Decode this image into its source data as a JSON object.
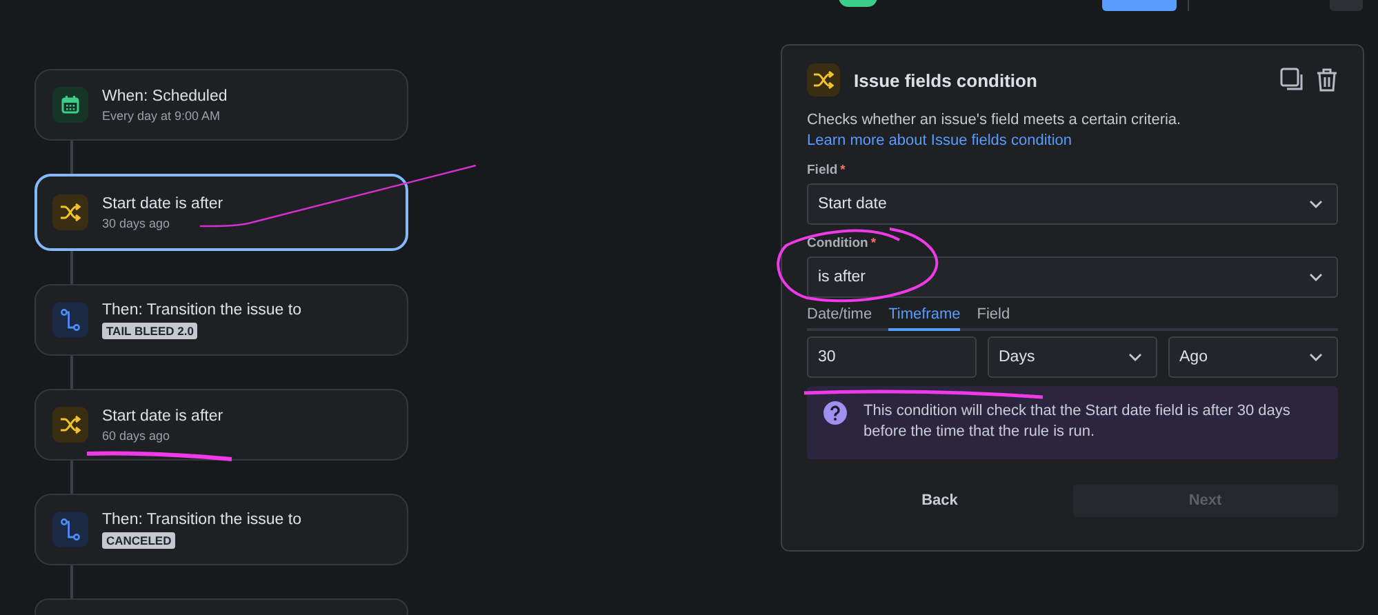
{
  "top_bar": {
    "toggle": {
      "on": true
    }
  },
  "flow": [
    {
      "kind": "trigger",
      "title": "When: Scheduled",
      "subtitle": "Every day at 9:00 AM",
      "selected": false
    },
    {
      "kind": "condition",
      "title": "Start date is after",
      "subtitle": "30 days ago",
      "selected": true
    },
    {
      "kind": "action",
      "title": "Then: Transition the issue to",
      "badge": "TAIL BLEED 2.0",
      "selected": false
    },
    {
      "kind": "condition",
      "title": "Start date is after",
      "subtitle": "60 days ago",
      "selected": false
    },
    {
      "kind": "action",
      "title": "Then: Transition the issue to",
      "badge": "CANCELED",
      "selected": false
    },
    {
      "kind": "empty",
      "selected": false
    }
  ],
  "panel": {
    "title": "Issue fields condition",
    "description": "Checks whether an issue's field meets a certain criteria.",
    "link": "Learn more about Issue fields condition",
    "field": {
      "label": "Field",
      "required_mark": "*",
      "value": "Start date"
    },
    "condition": {
      "label": "Condition",
      "required_mark": "*",
      "value": "is after"
    },
    "tabs": [
      {
        "label": "Date/time",
        "selected": false
      },
      {
        "label": "Timeframe",
        "selected": true
      },
      {
        "label": "Field",
        "selected": false
      }
    ],
    "amount": {
      "value": "30"
    },
    "unit": {
      "value": "Days"
    },
    "direction": {
      "value": "Ago"
    },
    "info": "This condition will check that the Start date field is after 30 days before the time that the rule is run.",
    "back_button": "Back",
    "next_button": {
      "label": "Next",
      "disabled": true
    }
  }
}
